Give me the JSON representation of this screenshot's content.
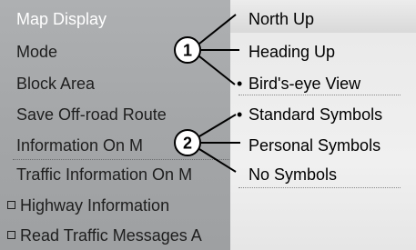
{
  "left_menu": {
    "items": [
      {
        "label": "Map Display",
        "selected": true
      },
      {
        "label": "Mode"
      },
      {
        "label": "Block Area"
      },
      {
        "label": "Save Off-road Route"
      },
      {
        "label": "Information On M"
      },
      {
        "label": "Traffic Information On M"
      },
      {
        "label": "Highway Information",
        "checkbox": true
      },
      {
        "label": "Read Traffic Messages A",
        "checkbox": true
      }
    ]
  },
  "right_menu": {
    "items": [
      {
        "label": "North Up"
      },
      {
        "label": "Heading Up"
      },
      {
        "label": "Bird's-eye View",
        "active": true
      },
      {
        "label": "Standard Symbols",
        "active": true
      },
      {
        "label": "Personal Symbols"
      },
      {
        "label": "No Symbols"
      }
    ]
  },
  "callouts": [
    {
      "number": "1"
    },
    {
      "number": "2"
    }
  ]
}
